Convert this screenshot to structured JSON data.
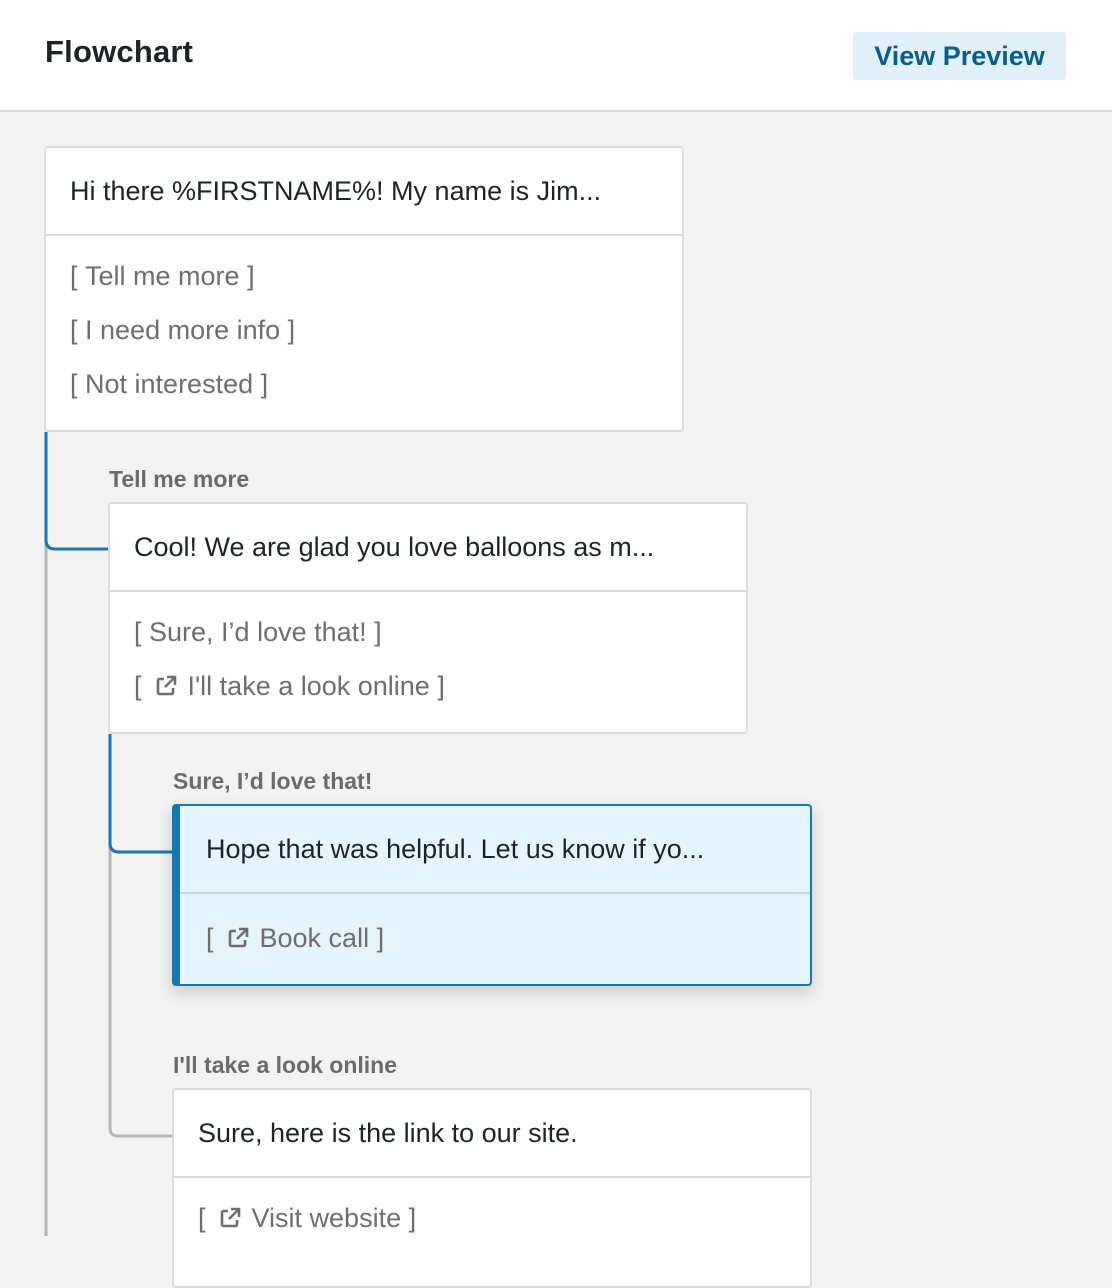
{
  "header": {
    "title": "Flowchart",
    "preview_button": "View Preview"
  },
  "nodes": {
    "root": {
      "message": "Hi there %FIRSTNAME%! My name is Jim...",
      "options": [
        "Tell me more",
        "I need more info",
        "Not interested"
      ]
    },
    "tell_me_more": {
      "branch_label": "Tell me more",
      "message": "Cool! We are glad you love balloons as m...",
      "options": [
        "Sure, I’d love that!",
        "I'll take a look online"
      ],
      "option_2_icon": "external-link-icon"
    },
    "sure": {
      "branch_label": "Sure, I’d love that!",
      "message": "Hope that was helpful. Let us know if yo...",
      "options": [
        "Book call"
      ],
      "option_1_icon": "external-link-icon"
    },
    "online": {
      "branch_label": "I'll take a look online",
      "message": "Sure, here is the link to our site.",
      "options": [
        "Visit website"
      ],
      "option_1_icon": "external-link-icon"
    }
  },
  "colors": {
    "accent": "#1977b0",
    "connector_gray": "#b5b5b5",
    "active_background": "#e5f5fd",
    "preview_button_bg": "#e1f1fb"
  }
}
